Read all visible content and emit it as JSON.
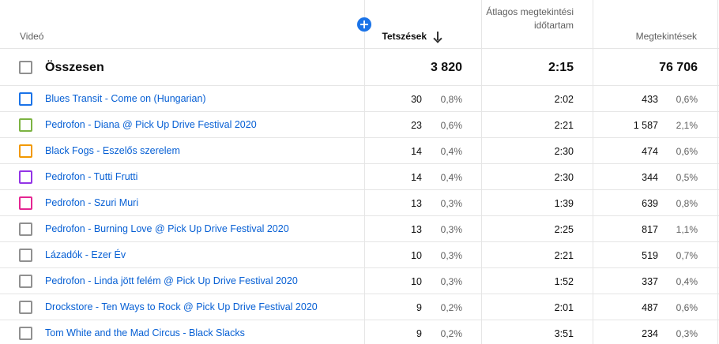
{
  "header": {
    "video": "Videó",
    "likes": "Tetszések",
    "avg_duration": "Átlagos megtekintési időtartam",
    "views": "Megtekintések"
  },
  "total": {
    "label": "Összesen",
    "likes": "3 820",
    "avg_duration": "2:15",
    "views": "76 706"
  },
  "rows": [
    {
      "title": "Blues Transit - Come on (Hungarian)",
      "likes": "30",
      "likes_pct": "0,8%",
      "avg": "2:02",
      "views": "433",
      "views_pct": "0,6%",
      "color": "#1a73e8"
    },
    {
      "title": "Pedrofon - Diana @ Pick Up Drive Festival 2020",
      "likes": "23",
      "likes_pct": "0,6%",
      "avg": "2:21",
      "views": "1 587",
      "views_pct": "2,1%",
      "color": "#7cb342"
    },
    {
      "title": "Black Fogs - Eszelős szerelem",
      "likes": "14",
      "likes_pct": "0,4%",
      "avg": "2:30",
      "views": "474",
      "views_pct": "0,6%",
      "color": "#f29900"
    },
    {
      "title": "Pedrofon - Tutti Frutti",
      "likes": "14",
      "likes_pct": "0,4%",
      "avg": "2:30",
      "views": "344",
      "views_pct": "0,5%",
      "color": "#9334e6"
    },
    {
      "title": "Pedrofon - Szuri Muri",
      "likes": "13",
      "likes_pct": "0,3%",
      "avg": "1:39",
      "views": "639",
      "views_pct": "0,8%",
      "color": "#e52592"
    },
    {
      "title": "Pedrofon - Burning Love @ Pick Up Drive Festival 2020",
      "likes": "13",
      "likes_pct": "0,3%",
      "avg": "2:25",
      "views": "817",
      "views_pct": "1,1%",
      "color": "#909090"
    },
    {
      "title": "Lázadók - Ezer Év",
      "likes": "10",
      "likes_pct": "0,3%",
      "avg": "2:21",
      "views": "519",
      "views_pct": "0,7%",
      "color": "#909090"
    },
    {
      "title": "Pedrofon - Linda jött felém @ Pick Up Drive Festival 2020",
      "likes": "10",
      "likes_pct": "0,3%",
      "avg": "1:52",
      "views": "337",
      "views_pct": "0,4%",
      "color": "#909090"
    },
    {
      "title": "Drockstore - Ten Ways to Rock @ Pick Up Drive Festival 2020",
      "likes": "9",
      "likes_pct": "0,2%",
      "avg": "2:01",
      "views": "487",
      "views_pct": "0,6%",
      "color": "#909090"
    },
    {
      "title": "Tom White and the Mad Circus - Black Slacks",
      "likes": "9",
      "likes_pct": "0,2%",
      "avg": "3:51",
      "views": "234",
      "views_pct": "0,3%",
      "color": "#909090"
    }
  ],
  "icons": {
    "add": "add-metric-icon",
    "sort": "sort-descending-arrow-icon"
  }
}
